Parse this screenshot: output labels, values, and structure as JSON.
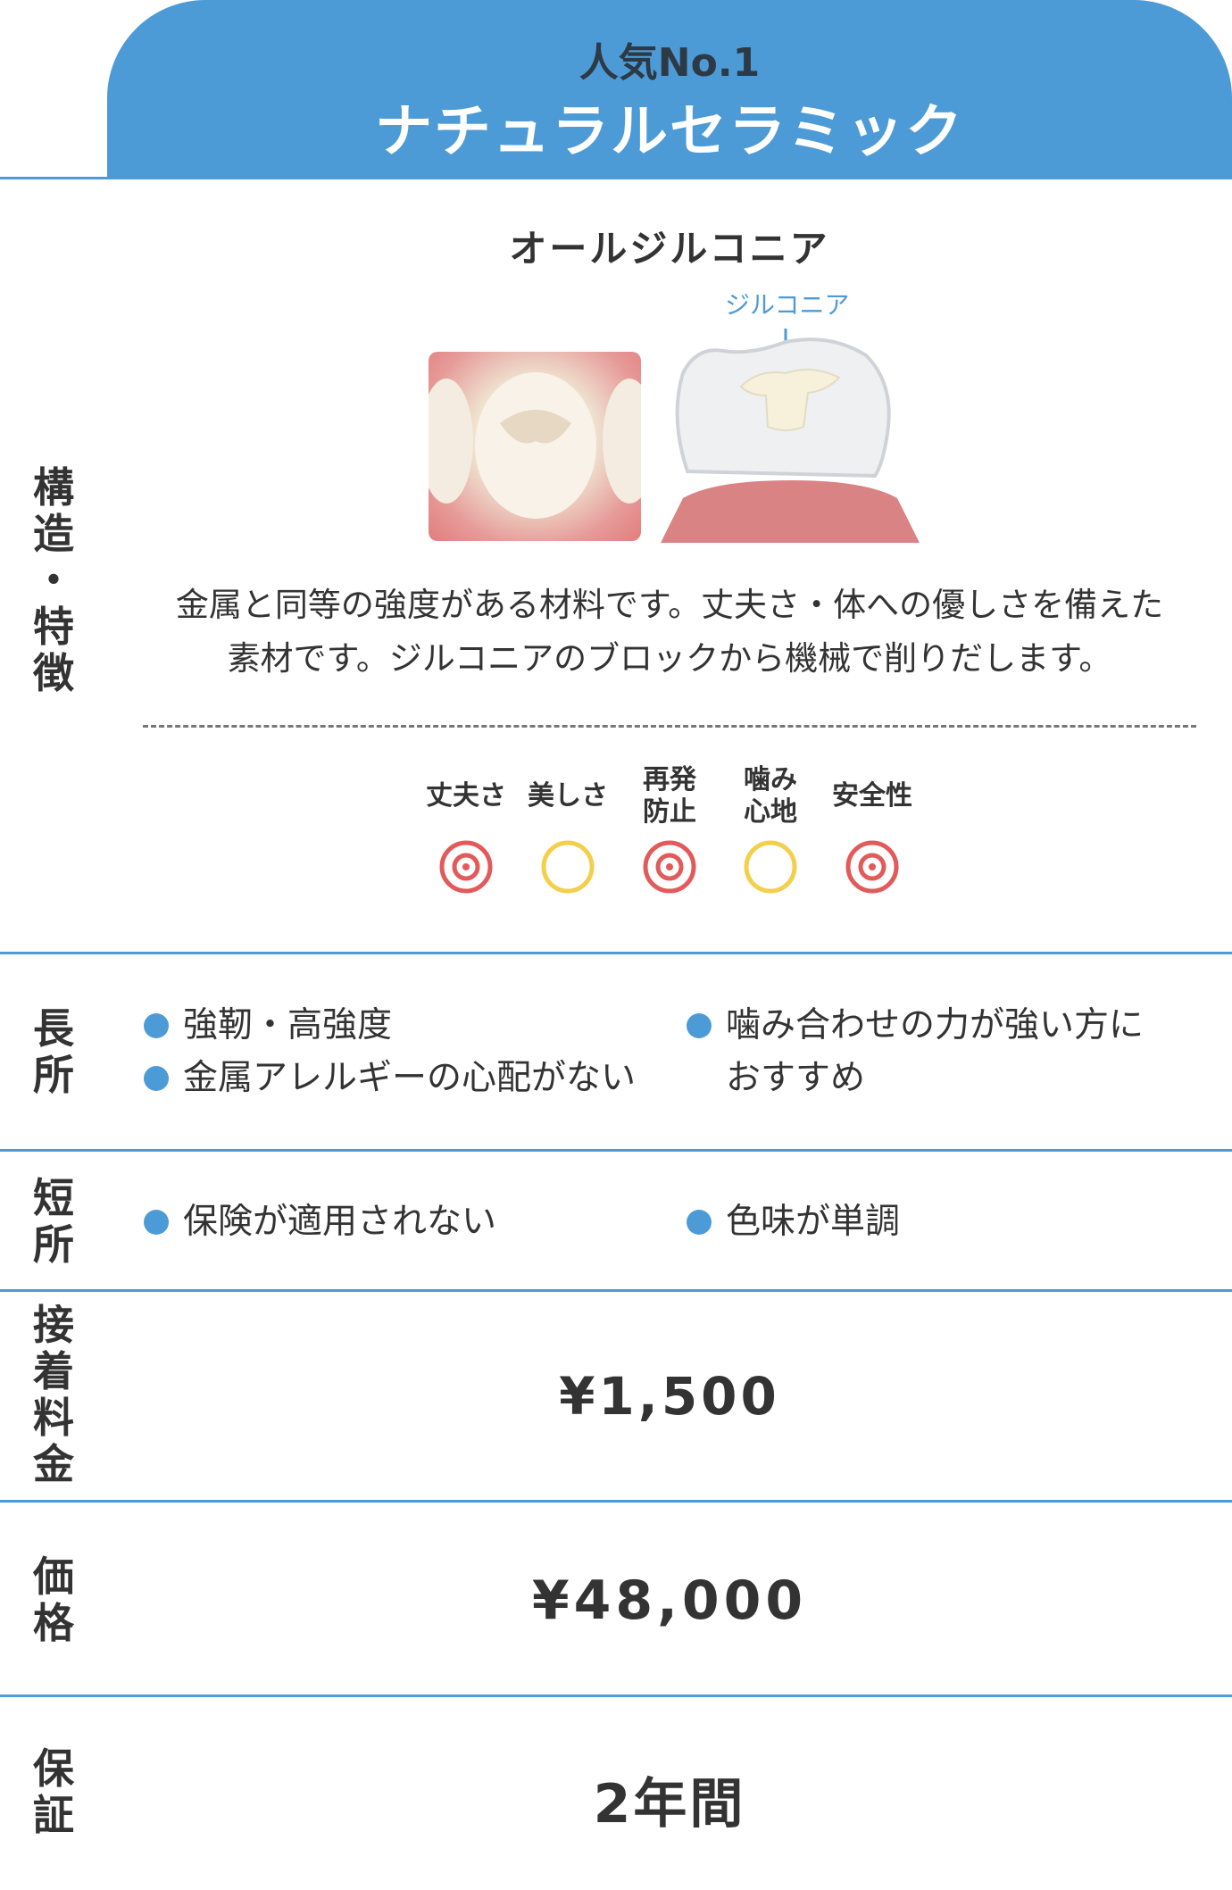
{
  "header": {
    "badge": "人気No.1",
    "title": "ナチュラルセラミック"
  },
  "features": {
    "row_label": "構\n造\n・\n特\n徴",
    "material_name": "オールジルコニア",
    "diagram_label": "ジルコニア",
    "description_line1": "金属と同等の強度がある材料です。丈夫さ・体への優しさを備えた",
    "description_line2": "素材です。ジルコニアのブロックから機械で削りだします。",
    "ratings": [
      {
        "label": "丈夫さ",
        "mark": "double-circle"
      },
      {
        "label": "美しさ",
        "mark": "circle"
      },
      {
        "label": "再発\n防止",
        "mark": "double-circle"
      },
      {
        "label": "噛み\n心地",
        "mark": "circle"
      },
      {
        "label": "安全性",
        "mark": "double-circle"
      }
    ]
  },
  "pros": {
    "row_label": "長\n所",
    "items": [
      "強靭・高強度",
      "金属アレルギーの心配がない",
      "噛み合わせの力が強い方に",
      "おすすめ"
    ]
  },
  "cons": {
    "row_label": "短\n所",
    "items": [
      "保険が適用されない",
      "色味が単調"
    ]
  },
  "bonding_fee": {
    "row_label": "接\n着\n料\n金",
    "value": "¥1,500"
  },
  "price": {
    "row_label": "価\n格",
    "value": "¥48,000"
  },
  "warranty": {
    "row_label": "保\n証",
    "value": "2年間"
  },
  "colors": {
    "accent": "#4d9bd6",
    "double_circle": "#e25a5a",
    "circle": "#f3cf4c",
    "gum": "#d98384"
  }
}
